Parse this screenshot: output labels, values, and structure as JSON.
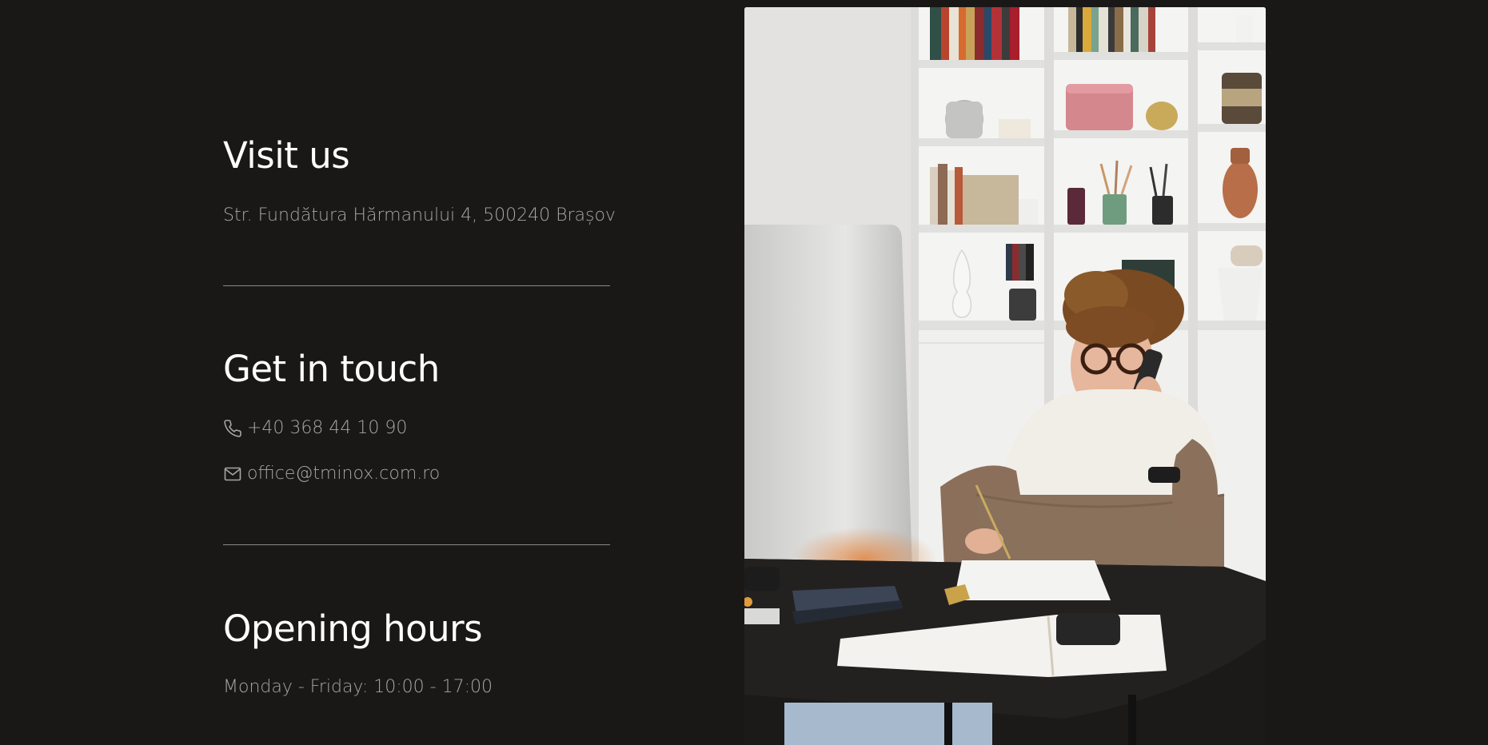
{
  "visit": {
    "heading": "Visit us",
    "address": "Str. Fundătura Hărmanului 4, 500240 Brașov"
  },
  "contact": {
    "heading": "Get in touch",
    "phone": "+40 368 44 10 90",
    "email": "office@tminox.com.ro"
  },
  "hours": {
    "heading": "Opening hours",
    "schedule": "Monday - Friday: 10:00 - 17:00"
  },
  "icons": {
    "phone": "phone-icon",
    "email": "mail-icon"
  },
  "colors": {
    "background": "#1a1817",
    "heading": "#ffffff",
    "text": "#a8a6a4",
    "divider": "#8b8987"
  }
}
